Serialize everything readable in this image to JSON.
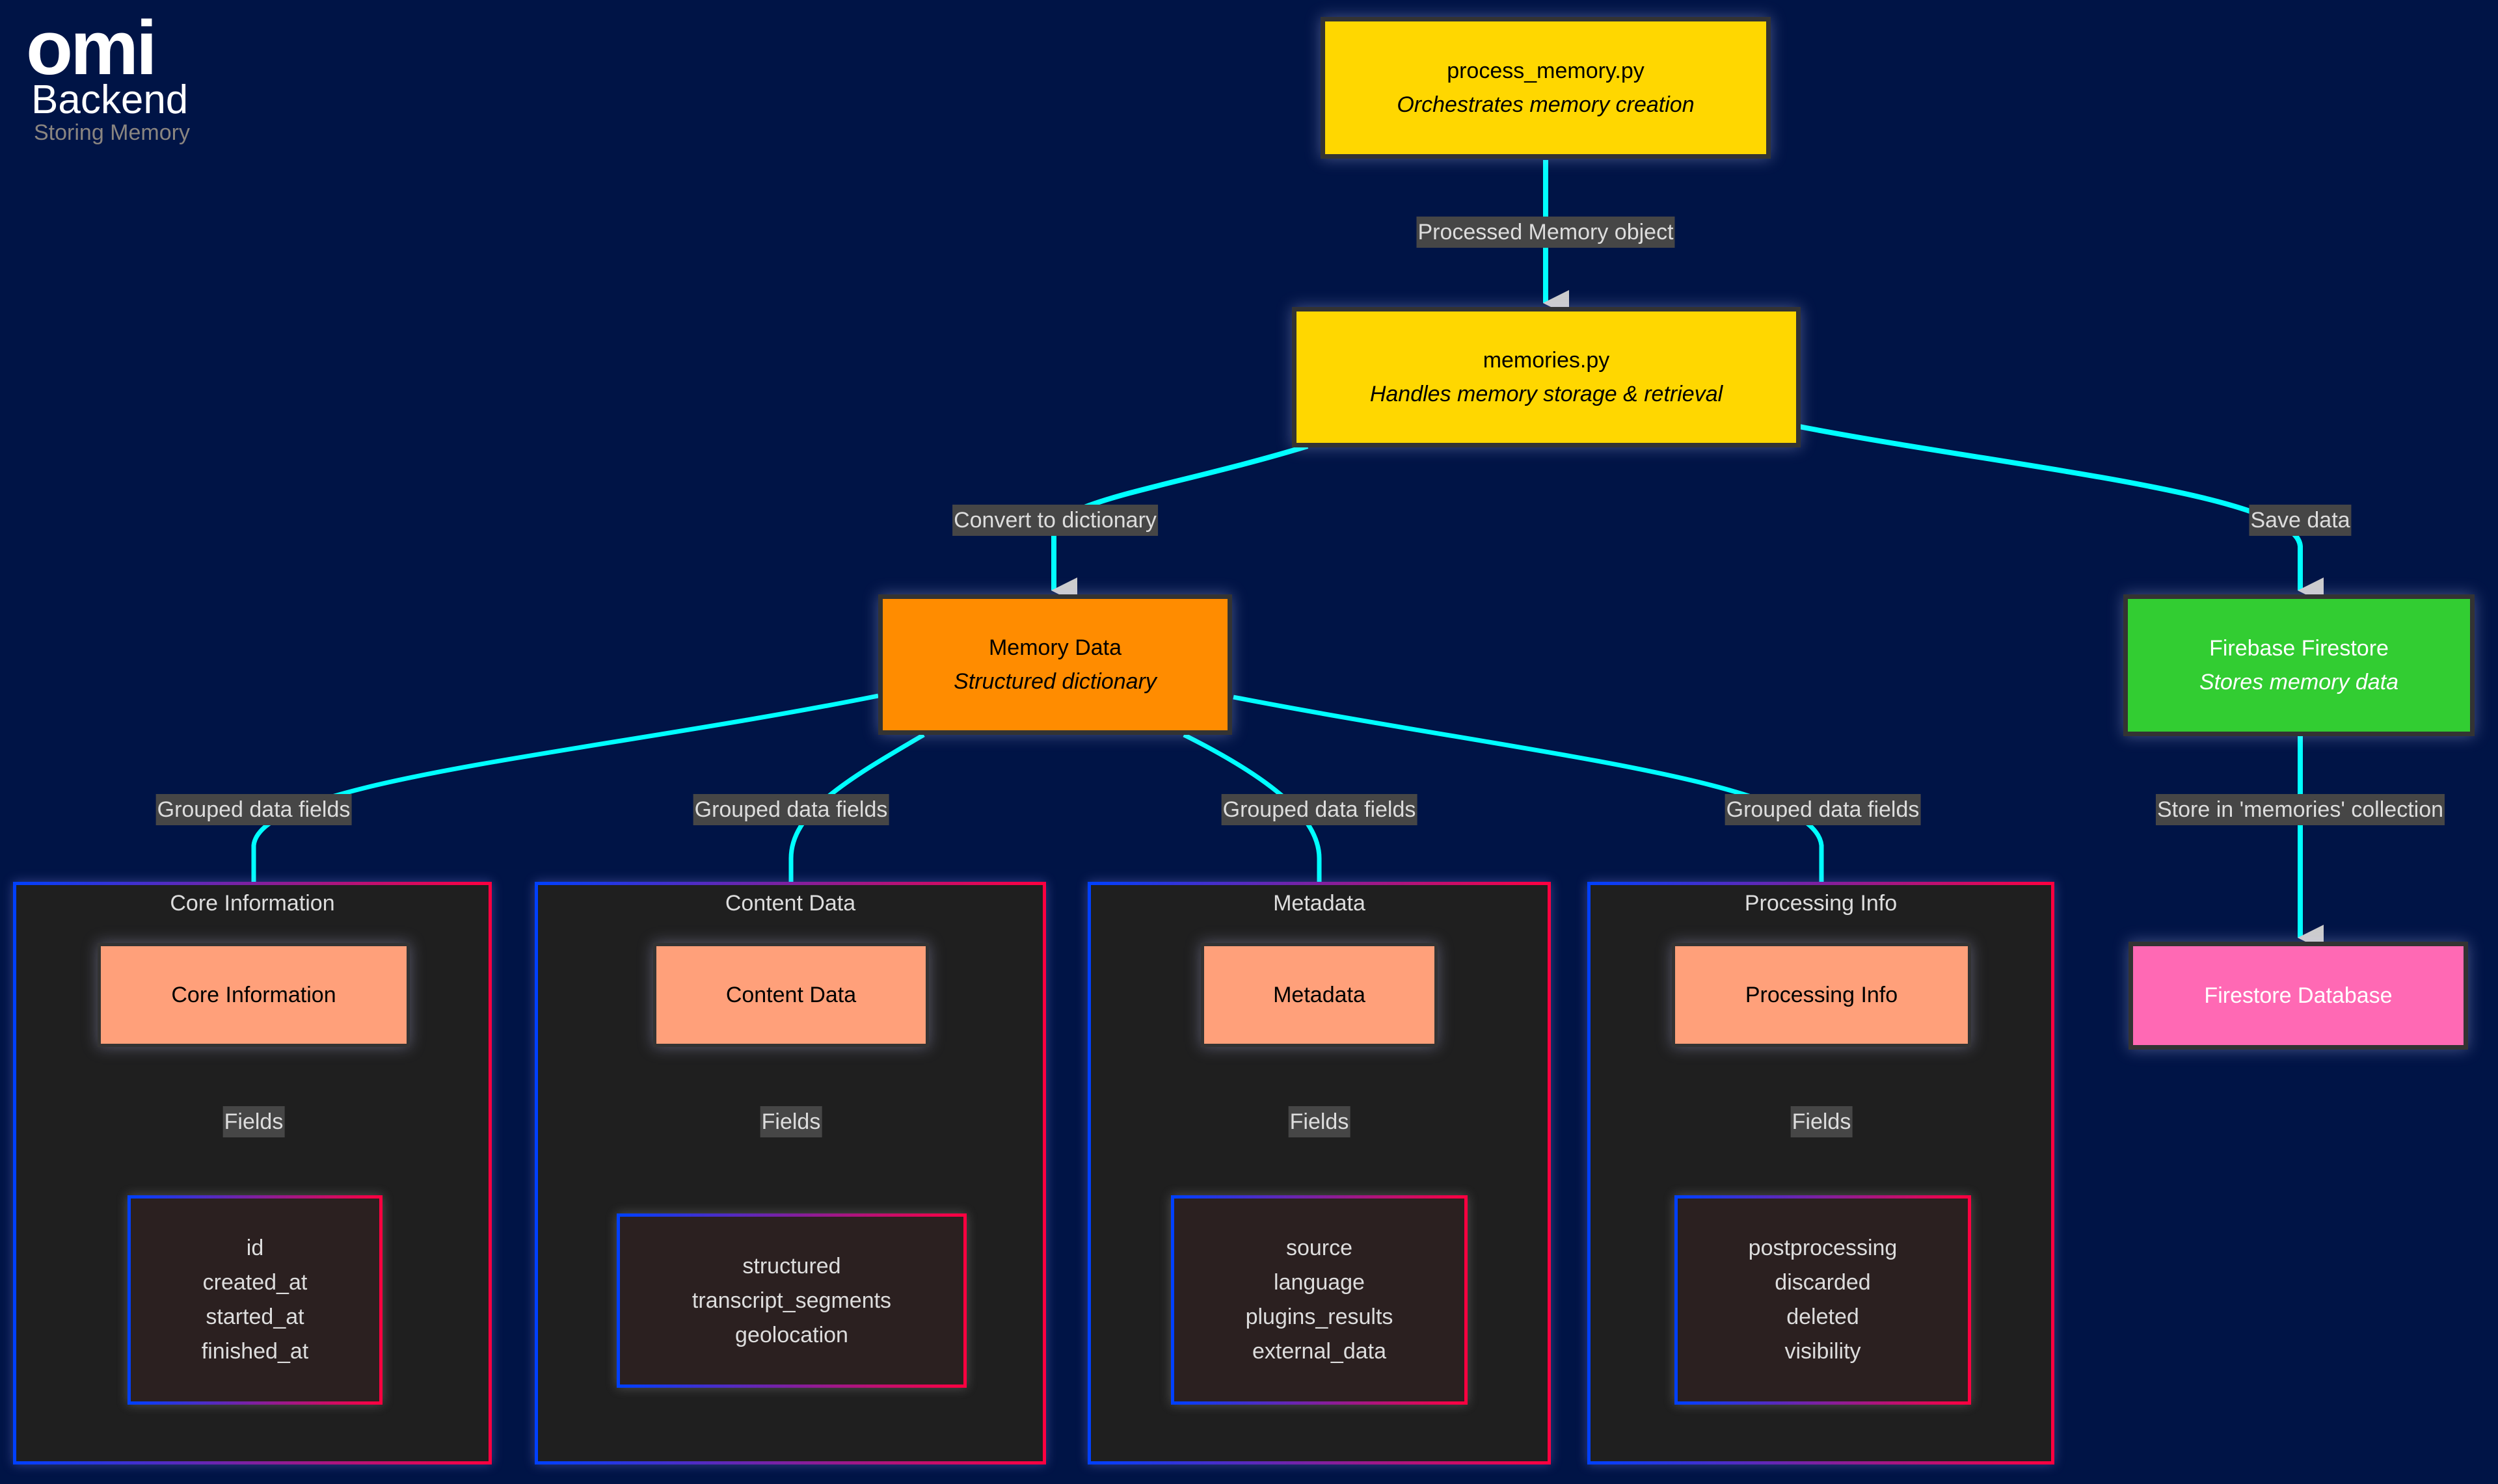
{
  "logo": {
    "brand": "omi",
    "product": "Backend",
    "subtitle": "Storing Memory"
  },
  "colors": {
    "background": "#001446",
    "edge": "#00FFFF",
    "arrowhead": "#CCCCCC",
    "edge_label_bg": "#464646",
    "process_node": "#FFD700",
    "memory_data_node": "#FF8C00",
    "firestore_node": "#32CD32",
    "database_node": "#FF69B4",
    "group_node": "#FFA07A",
    "cluster_bg": "#1F1F1F",
    "cluster_border_start": "#0040FF",
    "cluster_border_end": "#FF0040"
  },
  "nodes": {
    "process_memory": {
      "title": "process_memory.py",
      "subtitle": "Orchestrates memory creation"
    },
    "memories": {
      "title": "memories.py",
      "subtitle": "Handles memory storage & retrieval"
    },
    "memory_data": {
      "title": "Memory Data",
      "subtitle": "Structured dictionary"
    },
    "firestore": {
      "title": "Firebase Firestore",
      "subtitle": "Stores memory data"
    },
    "database": {
      "title": "Firestore Database"
    }
  },
  "clusters": [
    {
      "title": "Core Information",
      "node": "Core Information",
      "fields": [
        "id",
        "created_at",
        "started_at",
        "finished_at"
      ]
    },
    {
      "title": "Content Data",
      "node": "Content Data",
      "fields": [
        "structured",
        "transcript_segments",
        "geolocation"
      ]
    },
    {
      "title": "Metadata",
      "node": "Metadata",
      "fields": [
        "source",
        "language",
        "plugins_results",
        "external_data"
      ]
    },
    {
      "title": "Processing Info",
      "node": "Processing Info",
      "fields": [
        "postprocessing",
        "discarded",
        "deleted",
        "visibility"
      ]
    }
  ],
  "edges": {
    "processed_memory": "Processed Memory object",
    "convert": "Convert to dictionary",
    "save": "Save data",
    "grouped": "Grouped data fields",
    "fields": "Fields",
    "store": "Store in 'memories' collection"
  }
}
